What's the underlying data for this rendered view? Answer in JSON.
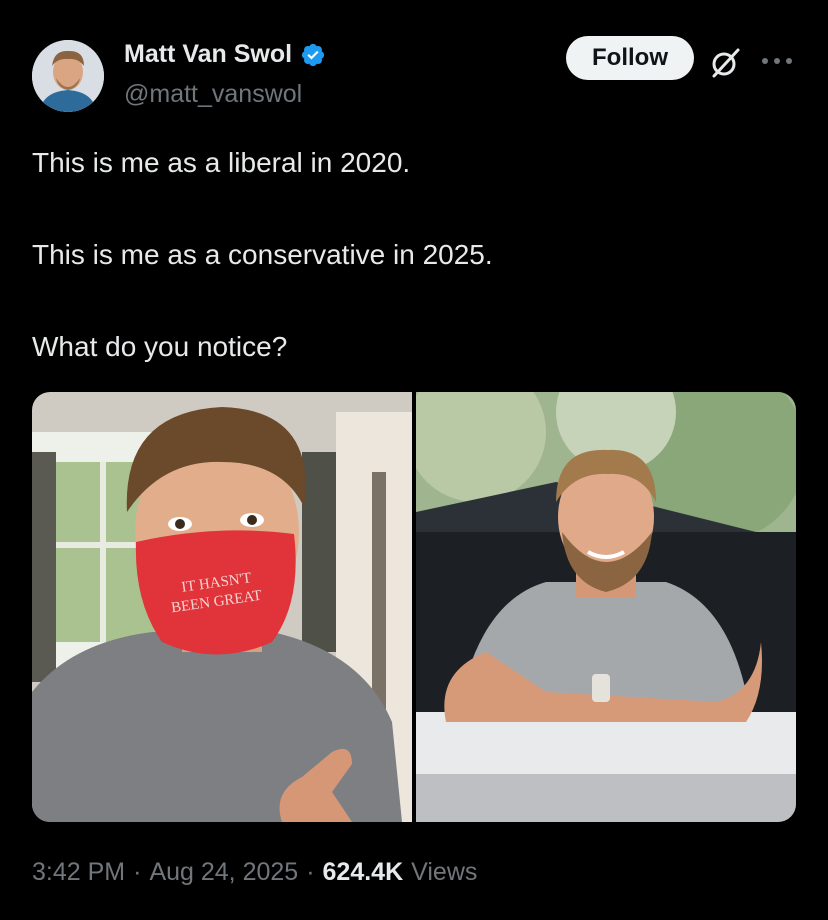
{
  "user": {
    "display_name": "Matt Van Swol",
    "handle": "@matt_vanswol",
    "verified": true,
    "verified_color": "#1d9bf0"
  },
  "actions": {
    "follow_label": "Follow",
    "grok_icon": "grok-icon",
    "more_icon": "more-icon"
  },
  "tweet": {
    "lines": [
      "This is me as a liberal in 2020.",
      "This is me as a conservative in 2025.",
      "What do you notice?"
    ]
  },
  "media": {
    "left_photo": {
      "mask_text_1": "IT HASN'T",
      "mask_text_2": "BEEN GREAT"
    },
    "right_photo": {}
  },
  "meta": {
    "time": "3:42 PM",
    "separator": "·",
    "date": "Aug 24, 2025",
    "views_count": "624.4K",
    "views_label": "Views"
  }
}
